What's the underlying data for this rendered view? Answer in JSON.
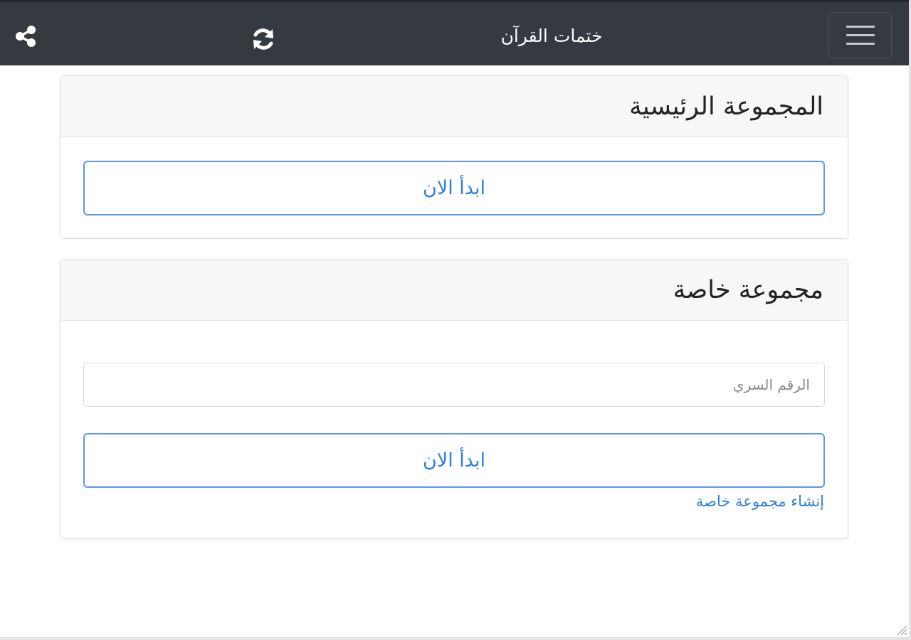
{
  "navbar": {
    "title": "ختمات القرآن",
    "share_icon": "share-icon",
    "refresh_icon": "refresh-icon",
    "menu_icon": "hamburger-menu-icon"
  },
  "main_group": {
    "title": "المجموعة الرئيسية",
    "start_label": "ابدأ الان"
  },
  "private_group": {
    "title": "مجموعة خاصة",
    "pin_placeholder": "الرقم السري",
    "pin_value": "",
    "start_label": "ابدأ الان",
    "create_link": "إنشاء مجموعة خاصة"
  },
  "colors": {
    "navbar_bg": "#343a40",
    "accent_blue": "#2f7de1",
    "card_header_bg": "#f7f7f7"
  }
}
